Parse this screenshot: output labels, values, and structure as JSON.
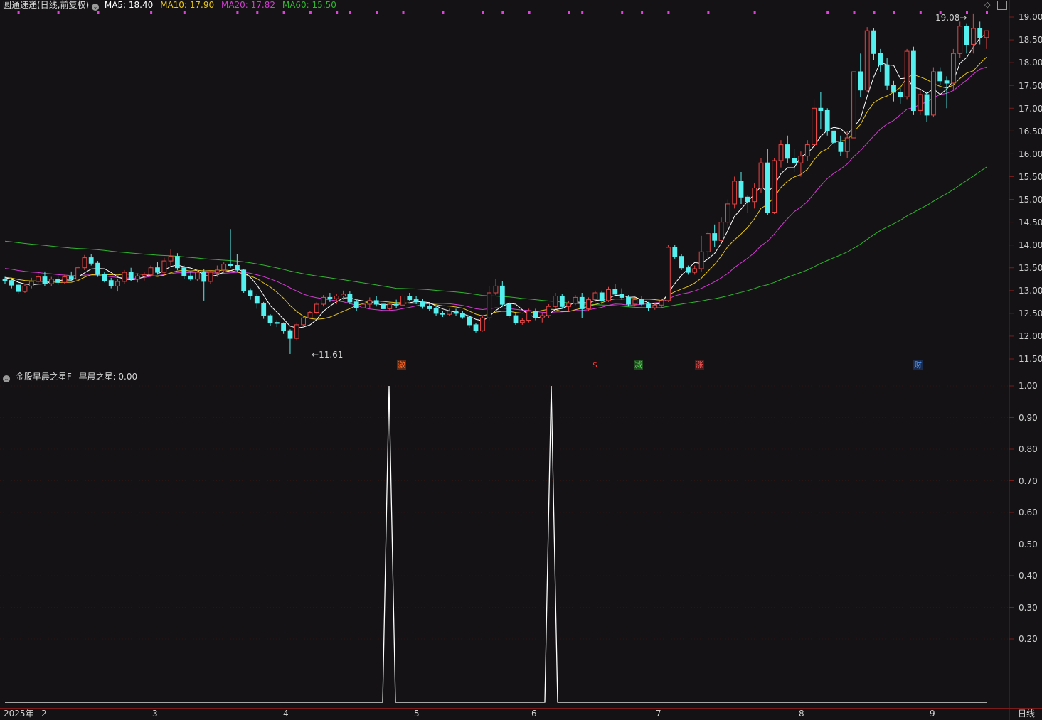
{
  "header": {
    "stock_title": "圆通速递(日线,前复权)",
    "ma5_label": "MA5: 18.40",
    "ma10_label": "MA10: 17.90",
    "ma20_label": "MA20: 17.82",
    "ma60_label": "MA60: 15.50",
    "ma_colors": {
      "ma5": "#ffffff",
      "ma10": "#e6c619",
      "ma20": "#d23cd2",
      "ma60": "#2fb52f"
    }
  },
  "indicator_header": {
    "name": "金股早晨之星F",
    "value_label": "早晨之星: 0.00"
  },
  "price_axis": {
    "labels": [
      "19.00",
      "18.50",
      "18.00",
      "17.50",
      "17.00",
      "16.50",
      "16.00",
      "15.50",
      "15.00",
      "14.50",
      "14.00",
      "13.50",
      "13.00",
      "12.50",
      "12.00",
      "11.50"
    ],
    "range": [
      11.45,
      19.25
    ]
  },
  "indicator_axis": {
    "labels": [
      "1.00",
      "0.90",
      "0.80",
      "0.70",
      "0.60",
      "0.50",
      "0.40",
      "0.30",
      "0.20"
    ],
    "range": [
      0,
      1
    ]
  },
  "time_axis": {
    "year_label": "2025年",
    "month_labels": [
      "2",
      "3",
      "4",
      "5",
      "6",
      "7",
      "8",
      "9"
    ],
    "period_button": "日线"
  },
  "annotations": {
    "low_label": "11.61",
    "high_label": "19.08"
  },
  "event_markers": [
    {
      "label": "激",
      "color": "#ff6a2a",
      "bg": "#5a2a14"
    },
    {
      "label": "$",
      "color": "#ff3a3a",
      "bg": "transparent"
    },
    {
      "label": "减",
      "color": "#58e058",
      "bg": "#1f4a1f"
    },
    {
      "label": "涨",
      "color": "#ff5a5a",
      "bg": "#4a1a1a"
    },
    {
      "label": "财",
      "color": "#5aa0ff",
      "bg": "#1a2a4a"
    }
  ],
  "chart_data": {
    "type": "candlestick",
    "series_notes": "daily OHLC, Jan 2025 - Sep 2025, forward-adjusted",
    "up_color": "#e54545",
    "down_color": "#54f0f0",
    "ohlc": [
      [
        13.25,
        13.3,
        13.15,
        13.22
      ],
      [
        13.22,
        13.28,
        13.05,
        13.12
      ],
      [
        13.12,
        13.15,
        12.92,
        12.98
      ],
      [
        12.98,
        13.15,
        12.95,
        13.1
      ],
      [
        13.1,
        13.28,
        13.05,
        13.2
      ],
      [
        13.2,
        13.38,
        13.15,
        13.3
      ],
      [
        13.3,
        13.42,
        13.1,
        13.15
      ],
      [
        13.15,
        13.3,
        13.1,
        13.25
      ],
      [
        13.25,
        13.32,
        13.12,
        13.18
      ],
      [
        13.18,
        13.35,
        13.15,
        13.3
      ],
      [
        13.3,
        13.42,
        13.2,
        13.25
      ],
      [
        13.25,
        13.55,
        13.2,
        13.5
      ],
      [
        13.5,
        13.78,
        13.45,
        13.72
      ],
      [
        13.72,
        13.8,
        13.55,
        13.6
      ],
      [
        13.6,
        13.65,
        13.3,
        13.35
      ],
      [
        13.35,
        13.4,
        13.18,
        13.22
      ],
      [
        13.22,
        13.28,
        13.05,
        13.1
      ],
      [
        13.1,
        13.25,
        12.98,
        13.2
      ],
      [
        13.2,
        13.45,
        13.15,
        13.4
      ],
      [
        13.4,
        13.5,
        13.2,
        13.25
      ],
      [
        13.25,
        13.38,
        13.18,
        13.32
      ],
      [
        13.32,
        13.4,
        13.22,
        13.35
      ],
      [
        13.35,
        13.55,
        13.3,
        13.5
      ],
      [
        13.5,
        13.62,
        13.35,
        13.4
      ],
      [
        13.4,
        13.72,
        13.35,
        13.65
      ],
      [
        13.65,
        13.9,
        13.55,
        13.75
      ],
      [
        13.75,
        13.82,
        13.45,
        13.5
      ],
      [
        13.5,
        13.55,
        13.25,
        13.32
      ],
      [
        13.32,
        13.4,
        13.2,
        13.25
      ],
      [
        13.25,
        13.45,
        13.2,
        13.4
      ],
      [
        13.4,
        13.48,
        12.78,
        13.2
      ],
      [
        13.2,
        13.45,
        13.15,
        13.4
      ],
      [
        13.4,
        13.55,
        13.3,
        13.45
      ],
      [
        13.45,
        13.62,
        13.4,
        13.58
      ],
      [
        13.58,
        14.35,
        13.5,
        13.55
      ],
      [
        13.55,
        13.8,
        13.4,
        13.45
      ],
      [
        13.45,
        13.48,
        12.95,
        13.0
      ],
      [
        13.0,
        13.05,
        12.8,
        12.88
      ],
      [
        12.88,
        12.92,
        12.6,
        12.72
      ],
      [
        12.72,
        12.75,
        12.38,
        12.45
      ],
      [
        12.45,
        12.48,
        12.22,
        12.3
      ],
      [
        12.3,
        12.35,
        12.2,
        12.28
      ],
      [
        12.28,
        12.3,
        12.05,
        12.12
      ],
      [
        12.12,
        12.15,
        11.61,
        11.95
      ],
      [
        11.95,
        12.3,
        11.9,
        12.25
      ],
      [
        12.25,
        12.45,
        12.2,
        12.4
      ],
      [
        12.4,
        12.55,
        12.38,
        12.52
      ],
      [
        12.52,
        12.75,
        12.48,
        12.7
      ],
      [
        12.7,
        12.9,
        12.65,
        12.85
      ],
      [
        12.85,
        12.95,
        12.75,
        12.82
      ],
      [
        12.82,
        12.92,
        12.7,
        12.88
      ],
      [
        12.88,
        13.0,
        12.8,
        12.92
      ],
      [
        12.92,
        12.98,
        12.7,
        12.75
      ],
      [
        12.75,
        12.8,
        12.55,
        12.62
      ],
      [
        12.62,
        12.75,
        12.55,
        12.7
      ],
      [
        12.7,
        12.85,
        12.6,
        12.78
      ],
      [
        12.78,
        12.88,
        12.65,
        12.7
      ],
      [
        12.7,
        12.75,
        12.35,
        12.6
      ],
      [
        12.6,
        12.75,
        12.55,
        12.7
      ],
      [
        12.7,
        12.8,
        12.62,
        12.68
      ],
      [
        12.68,
        12.92,
        12.65,
        12.88
      ],
      [
        12.88,
        12.95,
        12.78,
        12.8
      ],
      [
        12.8,
        12.88,
        12.7,
        12.75
      ],
      [
        12.75,
        12.82,
        12.6,
        12.65
      ],
      [
        12.65,
        12.72,
        12.55,
        12.6
      ],
      [
        12.6,
        12.65,
        12.45,
        12.5
      ],
      [
        12.5,
        12.55,
        12.42,
        12.48
      ],
      [
        12.48,
        12.6,
        12.45,
        12.55
      ],
      [
        12.55,
        12.6,
        12.45,
        12.5
      ],
      [
        12.5,
        12.55,
        12.38,
        12.42
      ],
      [
        12.42,
        12.45,
        12.18,
        12.25
      ],
      [
        12.25,
        12.28,
        12.08,
        12.12
      ],
      [
        12.12,
        12.45,
        12.1,
        12.4
      ],
      [
        12.4,
        13.1,
        12.35,
        12.95
      ],
      [
        12.95,
        13.25,
        12.9,
        13.1
      ],
      [
        13.1,
        13.2,
        12.65,
        12.7
      ],
      [
        12.7,
        12.75,
        12.4,
        12.45
      ],
      [
        12.45,
        12.5,
        12.25,
        12.3
      ],
      [
        12.3,
        12.4,
        12.25,
        12.35
      ],
      [
        12.35,
        12.6,
        12.3,
        12.55
      ],
      [
        12.55,
        12.6,
        12.35,
        12.4
      ],
      [
        12.4,
        12.5,
        12.3,
        12.45
      ],
      [
        12.45,
        12.7,
        12.4,
        12.65
      ],
      [
        12.65,
        12.95,
        12.6,
        12.88
      ],
      [
        12.88,
        12.92,
        12.6,
        12.65
      ],
      [
        12.65,
        12.78,
        12.55,
        12.72
      ],
      [
        12.72,
        12.9,
        12.68,
        12.85
      ],
      [
        12.85,
        12.95,
        12.4,
        12.6
      ],
      [
        12.6,
        12.85,
        12.55,
        12.8
      ],
      [
        12.8,
        13.0,
        12.75,
        12.95
      ],
      [
        12.95,
        13.0,
        12.7,
        12.78
      ],
      [
        12.78,
        13.08,
        12.75,
        13.02
      ],
      [
        13.02,
        13.15,
        12.88,
        12.92
      ],
      [
        12.92,
        13.05,
        12.8,
        12.85
      ],
      [
        12.85,
        12.9,
        12.65,
        12.7
      ],
      [
        12.7,
        12.85,
        12.65,
        12.8
      ],
      [
        12.8,
        12.88,
        12.65,
        12.7
      ],
      [
        12.7,
        12.75,
        12.55,
        12.62
      ],
      [
        12.62,
        12.7,
        12.58,
        12.68
      ],
      [
        12.68,
        12.82,
        12.62,
        12.78
      ],
      [
        12.78,
        14.0,
        12.75,
        13.95
      ],
      [
        13.95,
        14.0,
        13.7,
        13.75
      ],
      [
        13.75,
        13.8,
        13.45,
        13.5
      ],
      [
        13.5,
        13.55,
        13.35,
        13.4
      ],
      [
        13.4,
        13.55,
        13.35,
        13.48
      ],
      [
        13.48,
        14.2,
        13.42,
        13.85
      ],
      [
        13.85,
        14.3,
        13.7,
        14.25
      ],
      [
        14.25,
        14.45,
        13.95,
        14.1
      ],
      [
        14.1,
        14.6,
        14.05,
        14.5
      ],
      [
        14.5,
        15.0,
        14.4,
        14.9
      ],
      [
        14.9,
        15.5,
        14.8,
        15.4
      ],
      [
        15.4,
        15.6,
        14.9,
        15.05
      ],
      [
        15.05,
        15.1,
        14.7,
        14.95
      ],
      [
        14.95,
        15.35,
        14.8,
        15.25
      ],
      [
        15.25,
        15.9,
        15.15,
        15.8
      ],
      [
        15.8,
        16.1,
        14.65,
        14.72
      ],
      [
        14.72,
        15.9,
        14.68,
        15.85
      ],
      [
        15.85,
        16.3,
        15.7,
        16.2
      ],
      [
        16.2,
        16.4,
        15.8,
        15.9
      ],
      [
        15.9,
        16.1,
        15.6,
        15.8
      ],
      [
        15.8,
        16.05,
        15.5,
        15.95
      ],
      [
        15.95,
        16.3,
        15.85,
        16.2
      ],
      [
        16.2,
        17.2,
        16.1,
        17.0
      ],
      [
        17.0,
        17.35,
        16.55,
        16.95
      ],
      [
        16.95,
        17.0,
        16.4,
        16.5
      ],
      [
        16.5,
        16.65,
        16.1,
        16.25
      ],
      [
        16.25,
        16.4,
        15.95,
        16.05
      ],
      [
        16.05,
        16.5,
        15.9,
        16.35
      ],
      [
        16.35,
        17.9,
        16.3,
        17.8
      ],
      [
        17.8,
        18.2,
        17.25,
        17.4
      ],
      [
        17.4,
        18.78,
        17.35,
        18.7
      ],
      [
        18.7,
        18.75,
        18.05,
        18.2
      ],
      [
        18.2,
        18.3,
        17.8,
        17.95
      ],
      [
        17.95,
        18.1,
        17.4,
        17.5
      ],
      [
        17.5,
        17.6,
        17.15,
        17.35
      ],
      [
        17.35,
        17.45,
        17.1,
        17.25
      ],
      [
        17.25,
        18.3,
        17.2,
        18.25
      ],
      [
        18.25,
        18.35,
        16.85,
        16.95
      ],
      [
        16.95,
        17.4,
        16.85,
        17.3
      ],
      [
        17.3,
        17.35,
        16.7,
        16.85
      ],
      [
        16.85,
        17.9,
        16.8,
        17.8
      ],
      [
        17.8,
        17.9,
        17.5,
        17.6
      ],
      [
        17.6,
        17.7,
        17.0,
        17.55
      ],
      [
        17.55,
        18.3,
        17.4,
        18.2
      ],
      [
        18.2,
        18.9,
        18.1,
        18.8
      ],
      [
        18.8,
        18.85,
        18.2,
        18.4
      ],
      [
        18.4,
        19.08,
        18.2,
        18.75
      ],
      [
        18.75,
        18.9,
        18.4,
        18.55
      ],
      [
        18.55,
        18.7,
        18.3,
        18.7
      ]
    ],
    "indicator": {
      "name": "早晨之星",
      "peaks": [
        0.43,
        0.63
      ],
      "peak_value": 1.0,
      "baseline": 0.0
    }
  }
}
